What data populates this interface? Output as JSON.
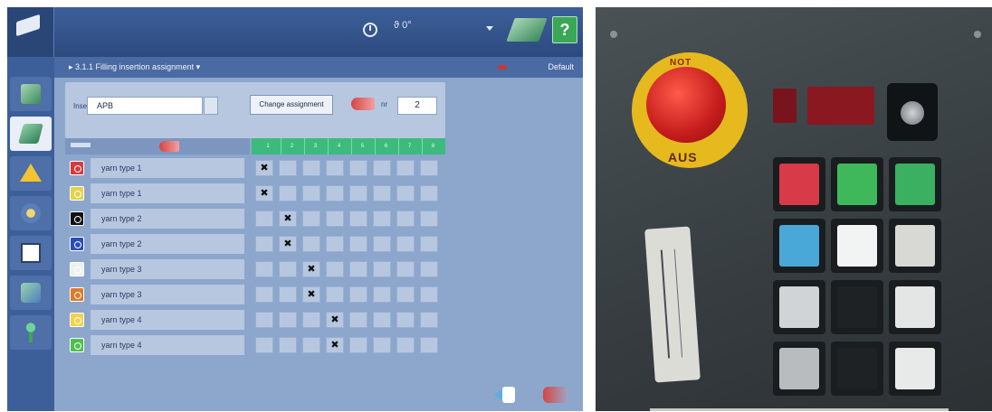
{
  "header": {
    "logo_subtext": "",
    "angle_readout": "ϑ 0°"
  },
  "sidebar": {
    "header_text": "",
    "footer_text": "",
    "items": [
      {
        "icon": "machine-icon"
      },
      {
        "icon": "weft-insertion-icon",
        "active": true
      },
      {
        "icon": "warning-icon"
      },
      {
        "icon": "settings-icon"
      },
      {
        "icon": "book-icon"
      },
      {
        "icon": "tools-icon"
      },
      {
        "icon": "operator-icon"
      }
    ]
  },
  "titlebar": {
    "caption": "▸ 3.1.1  Filling insertion assignment ▾",
    "right_label": "Default"
  },
  "form": {
    "field_label": "Insert",
    "field_value": "APB",
    "change_button": "Change assignment",
    "count_label": "nr",
    "count_value": "2"
  },
  "grid": {
    "header_cells": [
      "1",
      "2",
      "3",
      "4",
      "5",
      "6",
      "7",
      "8"
    ],
    "rows": [
      {
        "name": "yarn type 1",
        "color": "#d63a3a",
        "mark_col": 0
      },
      {
        "name": "yarn type 1",
        "color": "#e3d24a",
        "mark_col": 0
      },
      {
        "name": "yarn type 2",
        "color": "#111111",
        "mark_col": 1
      },
      {
        "name": "yarn type 2",
        "color": "#2a4fb5",
        "mark_col": 1
      },
      {
        "name": "yarn type 3",
        "color": "#f0f0f0",
        "mark_col": 2
      },
      {
        "name": "yarn type 3",
        "color": "#e07a2a",
        "mark_col": 2
      },
      {
        "name": "yarn type 4",
        "color": "#f2d24a",
        "mark_col": 3
      },
      {
        "name": "yarn type 4",
        "color": "#4fc04f",
        "mark_col": 3
      }
    ],
    "mark": "✖"
  },
  "panel": {
    "estop_top": "NOT",
    "estop_bottom": "AUS",
    "button_colors": [
      [
        "#d83a48",
        "#3eb85a",
        "#3ab060"
      ],
      [
        "#4aa8d8",
        "#f2f4f4",
        "#d8d8d4"
      ],
      [
        "#d0d4d6",
        "#1e2225",
        "#e4e6e6"
      ],
      [
        "#b8bcbe",
        "#1e2225",
        "#e8eaea"
      ]
    ]
  }
}
